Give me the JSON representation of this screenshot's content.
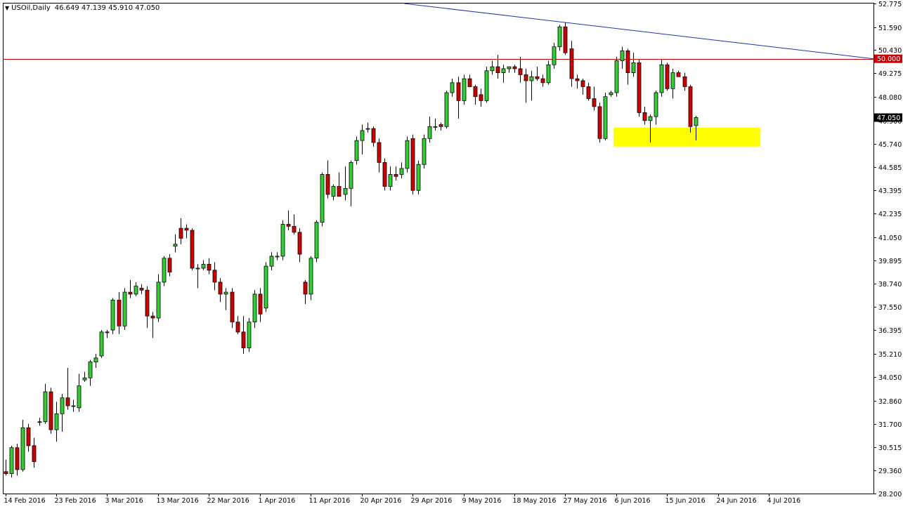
{
  "chart_header": {
    "symbol": "USOil,Daily",
    "open": "46.649",
    "high": "47.139",
    "low": "45.910",
    "close": "47.050",
    "collapse_icon": "triangle-down-icon"
  },
  "colors": {
    "background": "#ffffff",
    "frame": "#000000",
    "bull_body": "#32cd32",
    "bear_body": "#cc0000",
    "wick": "#000000",
    "resistance_line": "#cc0000",
    "trend_line": "#1f33aa",
    "support_zone": "#ffff00",
    "current_price_tag": "#000000"
  },
  "chart_data": {
    "type": "candlestick",
    "title": "USOil,Daily",
    "ylim": [
      28.2,
      52.77
    ],
    "y_ticks": [
      "52.775",
      "51.590",
      "50.430",
      "49.275",
      "48.080",
      "46.900",
      "45.740",
      "44.585",
      "43.395",
      "42.235",
      "41.050",
      "39.895",
      "38.740",
      "37.550",
      "36.395",
      "35.210",
      "34.050",
      "32.860",
      "31.700",
      "30.515",
      "29.360",
      "28.200"
    ],
    "x_ticks": [
      "14 Feb 2016",
      "23 Feb 2016",
      "3 Mar 2016",
      "13 Mar 2016",
      "22 Mar 2016",
      "1 Apr 2016",
      "11 Apr 2016",
      "20 Apr 2016",
      "29 Apr 2016",
      "9 May 2016",
      "18 May 2016",
      "27 May 2016",
      "6 Jun 2016",
      "15 Jun 2016",
      "24 Jun 2016",
      "4 Jul 2016"
    ],
    "x_tick_index": [
      0,
      9,
      18,
      27,
      36,
      45,
      54,
      63,
      72,
      81,
      90,
      99,
      108,
      117,
      126,
      135
    ],
    "candles": [
      [
        29.3,
        29.9,
        29.1,
        29.2
      ],
      [
        29.2,
        30.6,
        29.0,
        30.5
      ],
      [
        30.5,
        30.7,
        29.1,
        29.4
      ],
      [
        29.4,
        31.9,
        29.3,
        31.5
      ],
      [
        31.5,
        31.7,
        30.3,
        30.6
      ],
      [
        30.6,
        31.0,
        29.5,
        29.8
      ],
      [
        31.8,
        32.0,
        31.6,
        31.8
      ],
      [
        31.8,
        33.7,
        31.7,
        33.3
      ],
      [
        33.3,
        33.5,
        31.2,
        31.4
      ],
      [
        31.4,
        32.8,
        30.8,
        32.2
      ],
      [
        32.2,
        33.2,
        31.3,
        33.0
      ],
      [
        33.0,
        34.5,
        32.4,
        32.6
      ],
      [
        32.6,
        32.9,
        32.3,
        32.6
      ],
      [
        32.5,
        34.2,
        32.3,
        33.6
      ],
      [
        33.9,
        34.3,
        33.8,
        34.0
      ],
      [
        34.0,
        34.9,
        33.6,
        34.8
      ],
      [
        34.8,
        35.2,
        34.5,
        35.0
      ],
      [
        35.1,
        36.4,
        35.0,
        36.3
      ],
      [
        36.3,
        36.4,
        36.0,
        36.3
      ],
      [
        36.4,
        38.0,
        36.2,
        37.9
      ],
      [
        37.9,
        38.3,
        36.2,
        36.6
      ],
      [
        36.6,
        38.5,
        36.4,
        38.3
      ],
      [
        38.3,
        38.9,
        38.0,
        38.2
      ],
      [
        38.2,
        38.8,
        38.1,
        38.6
      ],
      [
        38.5,
        38.7,
        38.2,
        38.4
      ],
      [
        38.4,
        38.6,
        36.5,
        37.1
      ],
      [
        37.1,
        37.3,
        36.0,
        37.0
      ],
      [
        37.0,
        39.2,
        36.8,
        38.8
      ],
      [
        38.8,
        40.1,
        38.6,
        40.0
      ],
      [
        40.0,
        40.2,
        39.1,
        39.3
      ],
      [
        40.6,
        41.2,
        40.3,
        40.7
      ],
      [
        41.5,
        42.0,
        40.7,
        41.0
      ],
      [
        41.5,
        41.7,
        41.0,
        41.4
      ],
      [
        41.4,
        41.5,
        39.4,
        39.5
      ],
      [
        39.5,
        39.7,
        38.5,
        39.5
      ],
      [
        39.5,
        39.9,
        39.4,
        39.7
      ],
      [
        39.7,
        40.0,
        39.2,
        39.4
      ],
      [
        39.4,
        39.8,
        38.4,
        38.8
      ],
      [
        38.8,
        39.0,
        37.8,
        38.2
      ],
      [
        38.2,
        38.5,
        37.4,
        38.3
      ],
      [
        38.3,
        38.5,
        36.5,
        36.8
      ],
      [
        36.8,
        37.1,
        36.2,
        36.3
      ],
      [
        36.3,
        37.1,
        35.2,
        35.5
      ],
      [
        35.5,
        37.0,
        35.3,
        36.8
      ],
      [
        36.8,
        38.4,
        36.5,
        38.2
      ],
      [
        38.2,
        38.5,
        36.8,
        37.2
      ],
      [
        37.5,
        39.8,
        37.3,
        39.6
      ],
      [
        39.6,
        40.3,
        39.4,
        40.1
      ],
      [
        40.1,
        40.3,
        39.9,
        40.1
      ],
      [
        40.1,
        41.9,
        39.9,
        41.7
      ],
      [
        41.7,
        42.4,
        41.4,
        41.6
      ],
      [
        41.6,
        42.2,
        41.2,
        41.3
      ],
      [
        41.3,
        41.5,
        39.8,
        40.2
      ],
      [
        38.8,
        38.9,
        37.7,
        38.2
      ],
      [
        38.2,
        40.1,
        37.9,
        40.0
      ],
      [
        40.0,
        41.9,
        39.8,
        41.8
      ],
      [
        41.8,
        44.3,
        41.6,
        44.2
      ],
      [
        44.2,
        44.9,
        43.0,
        43.2
      ],
      [
        43.1,
        43.7,
        42.9,
        43.6
      ],
      [
        43.6,
        44.3,
        43.1,
        43.1
      ],
      [
        43.2,
        44.6,
        42.9,
        43.5
      ],
      [
        43.5,
        44.9,
        42.6,
        44.8
      ],
      [
        44.9,
        46.1,
        44.7,
        45.9
      ],
      [
        45.9,
        46.7,
        45.2,
        46.4
      ],
      [
        46.5,
        46.8,
        46.3,
        46.5
      ],
      [
        46.5,
        46.6,
        45.6,
        45.8
      ],
      [
        45.8,
        46.0,
        44.3,
        44.8
      ],
      [
        44.8,
        45.0,
        43.4,
        43.6
      ],
      [
        43.6,
        44.6,
        43.4,
        44.2
      ],
      [
        44.2,
        44.6,
        43.9,
        44.1
      ],
      [
        44.2,
        44.8,
        44.0,
        44.5
      ],
      [
        44.5,
        46.1,
        44.3,
        45.9
      ],
      [
        46.0,
        46.2,
        43.2,
        43.4
      ],
      [
        43.4,
        44.9,
        43.2,
        44.7
      ],
      [
        44.7,
        46.2,
        44.5,
        46.0
      ],
      [
        46.0,
        47.1,
        45.8,
        46.6
      ],
      [
        46.6,
        47.0,
        46.4,
        46.6
      ],
      [
        46.7,
        46.8,
        46.4,
        46.6
      ],
      [
        46.6,
        48.4,
        46.5,
        48.3
      ],
      [
        48.3,
        49.0,
        48.1,
        48.8
      ],
      [
        48.8,
        49.1,
        47.0,
        47.9
      ],
      [
        47.9,
        49.2,
        47.7,
        49.0
      ],
      [
        49.0,
        49.2,
        48.6,
        48.6
      ],
      [
        48.6,
        48.7,
        47.7,
        48.1
      ],
      [
        48.2,
        48.5,
        47.6,
        47.9
      ],
      [
        47.9,
        49.6,
        47.8,
        49.4
      ],
      [
        49.4,
        49.9,
        49.2,
        49.6
      ],
      [
        49.6,
        50.2,
        49.0,
        49.3
      ],
      [
        49.3,
        49.7,
        48.8,
        49.5
      ],
      [
        49.5,
        49.6,
        49.3,
        49.6
      ],
      [
        49.6,
        49.7,
        49.3,
        49.5
      ],
      [
        49.5,
        50.1,
        48.8,
        49.2
      ],
      [
        49.2,
        49.5,
        47.8,
        48.9
      ],
      [
        48.9,
        49.4,
        47.9,
        49.1
      ],
      [
        49.1,
        49.6,
        48.9,
        49.0
      ],
      [
        49.0,
        49.2,
        48.6,
        48.8
      ],
      [
        48.8,
        49.9,
        48.7,
        49.7
      ],
      [
        49.7,
        50.8,
        49.5,
        50.6
      ],
      [
        50.6,
        51.7,
        50.4,
        51.6
      ],
      [
        51.6,
        51.8,
        50.2,
        50.3
      ],
      [
        50.5,
        50.9,
        48.6,
        49.0
      ],
      [
        49.0,
        49.2,
        48.5,
        48.9
      ],
      [
        48.9,
        49.0,
        48.2,
        48.6
      ],
      [
        48.6,
        48.8,
        47.9,
        48.0
      ],
      [
        48.0,
        48.6,
        47.4,
        47.6
      ],
      [
        47.6,
        47.8,
        45.8,
        46.0
      ],
      [
        46.0,
        48.3,
        45.9,
        48.1
      ],
      [
        48.2,
        48.4,
        48.1,
        48.3
      ],
      [
        48.3,
        50.1,
        48.1,
        49.9
      ],
      [
        49.9,
        50.6,
        49.5,
        50.4
      ],
      [
        50.4,
        50.5,
        48.7,
        49.3
      ],
      [
        49.3,
        50.3,
        49.1,
        49.8
      ],
      [
        49.8,
        50.0,
        47.1,
        47.3
      ],
      [
        47.3,
        47.6,
        46.7,
        46.9
      ],
      [
        46.9,
        47.2,
        45.8,
        47.1
      ],
      [
        47.1,
        48.4,
        46.7,
        48.3
      ],
      [
        48.3,
        50.0,
        48.1,
        49.7
      ],
      [
        49.7,
        49.8,
        48.4,
        48.5
      ],
      [
        48.5,
        49.5,
        48.0,
        49.3
      ],
      [
        49.3,
        49.4,
        49.1,
        49.1
      ],
      [
        49.1,
        49.3,
        48.4,
        48.6
      ],
      [
        48.6,
        48.7,
        46.3,
        46.6
      ],
      [
        46.649,
        47.139,
        45.91,
        47.05
      ]
    ],
    "candle_x_index": [
      0,
      1,
      2,
      3,
      4,
      5,
      6,
      7,
      8,
      9,
      10,
      11,
      12,
      13,
      14,
      15,
      16,
      17,
      18,
      19,
      20,
      21,
      22,
      23,
      24,
      25,
      26,
      27,
      28,
      29,
      30,
      31,
      32,
      33,
      34,
      35,
      36,
      37,
      38,
      39,
      40,
      41,
      42,
      43,
      44,
      45,
      46,
      47,
      48,
      49,
      50,
      51,
      52,
      53,
      54,
      55,
      56,
      57,
      58,
      59,
      60,
      61,
      62,
      63,
      64,
      65,
      66,
      67,
      68,
      69,
      70,
      71,
      72,
      73,
      74,
      75,
      76,
      77,
      78,
      79,
      80,
      81,
      82,
      83,
      84,
      85,
      86,
      87,
      88,
      89,
      90,
      91,
      92,
      93,
      94,
      95,
      96,
      97,
      98,
      99,
      100,
      101,
      102,
      103,
      104,
      105,
      106,
      107,
      108,
      109,
      110,
      111,
      112,
      113,
      114,
      115,
      116,
      117,
      118,
      119,
      120,
      121,
      122,
      123
    ],
    "resistance_level": 50.0,
    "resistance_label": "50.000",
    "current_price": 47.05,
    "current_price_label": "47.050",
    "trendline": {
      "x1_index": 70.5,
      "y1": 52.77,
      "x2_index": 163.0,
      "y2": 50.0
    },
    "support_zone": {
      "x1_index": 107.5,
      "x2_index": 133.5,
      "y_low": 45.6,
      "y_high": 46.55
    }
  }
}
